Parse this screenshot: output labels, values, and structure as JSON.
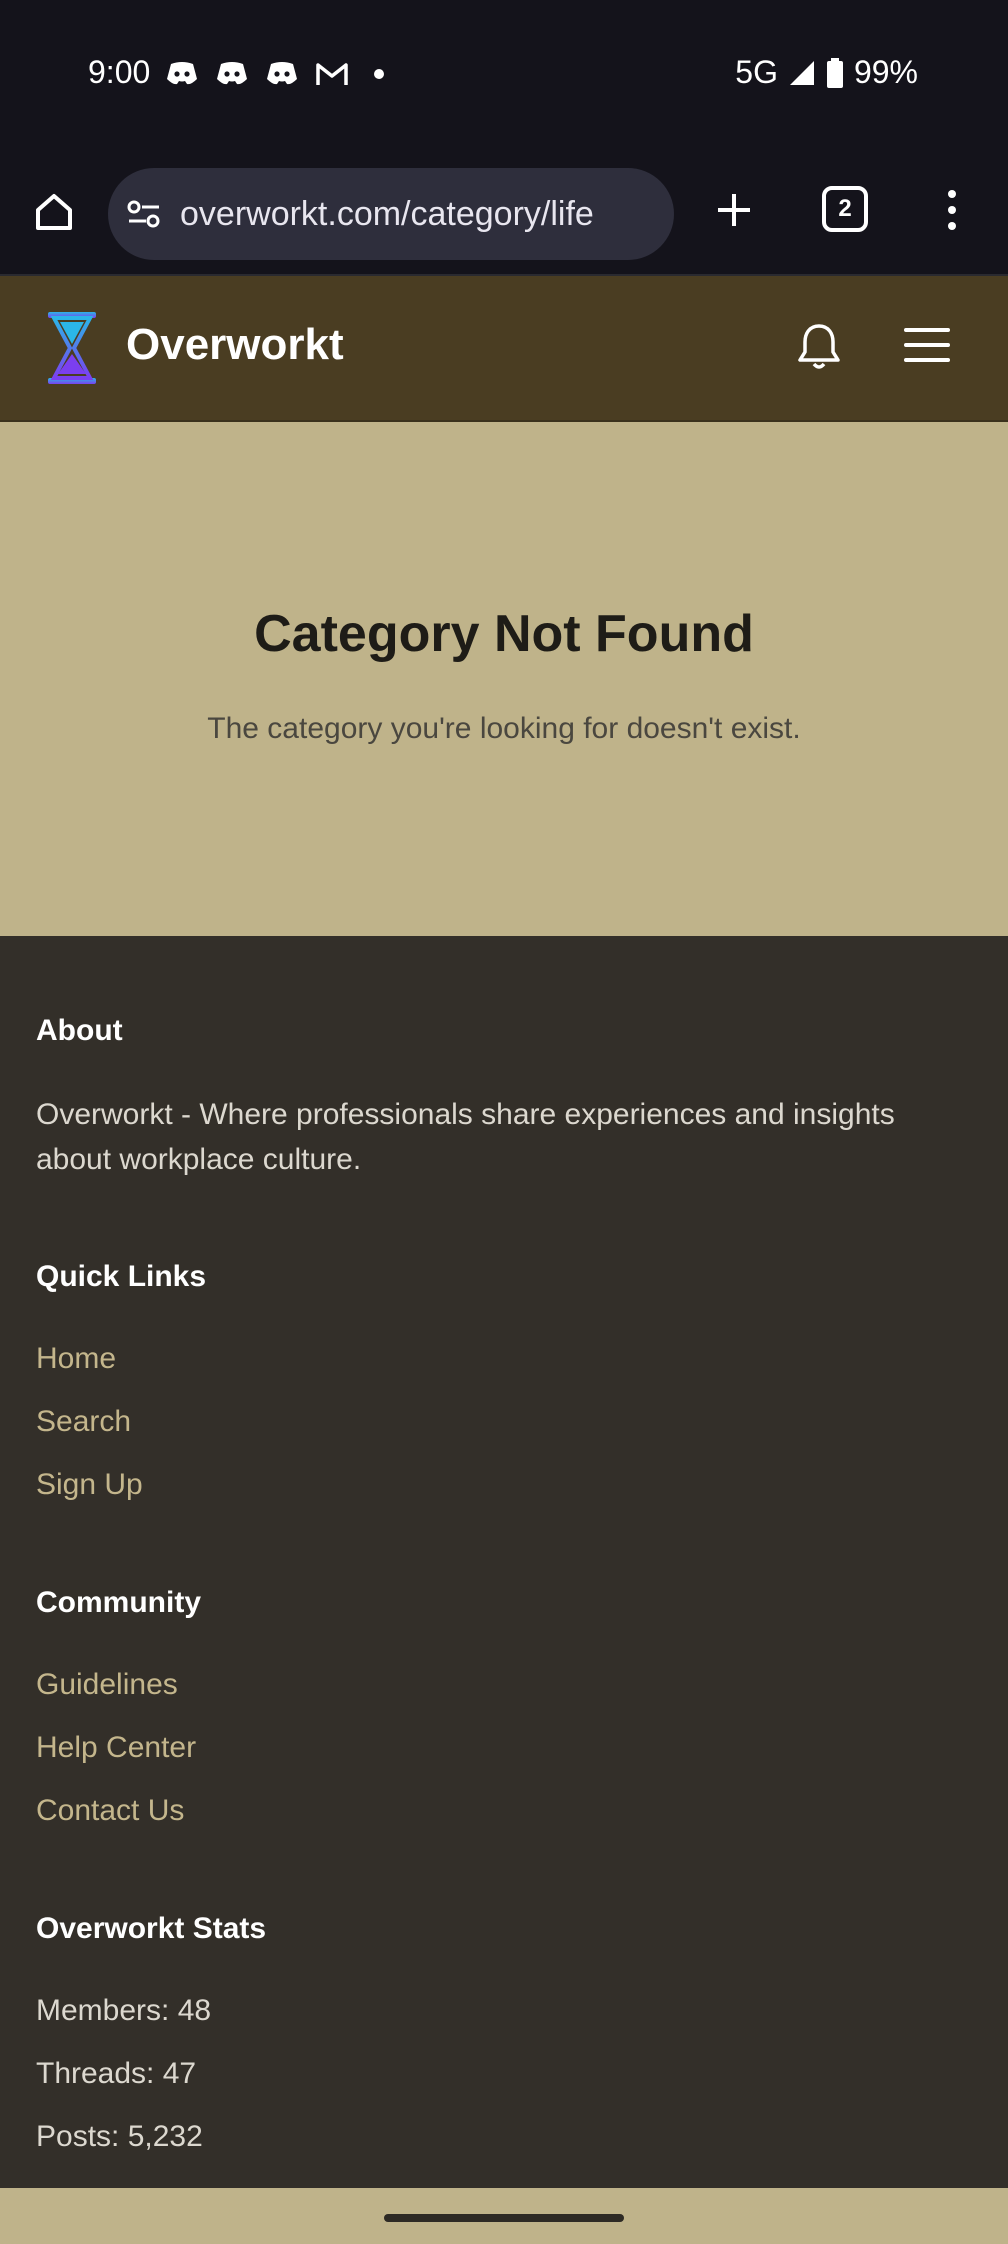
{
  "status_bar": {
    "time": "9:00",
    "network": "5G",
    "battery": "99%",
    "notification_icons": [
      "discord-icon",
      "discord-icon",
      "discord-icon",
      "gmail-icon"
    ]
  },
  "browser": {
    "url": "overworkt.com/category/life",
    "tab_count": "2"
  },
  "site": {
    "name": "Overworkt"
  },
  "main": {
    "title": "Category Not Found",
    "subtitle": "The category you're looking for doesn't exist."
  },
  "footer": {
    "about": {
      "heading": "About",
      "text": "Overworkt - Where professionals share experiences and insights about workplace culture."
    },
    "quick_links": {
      "heading": "Quick Links",
      "items": [
        "Home",
        "Search",
        "Sign Up"
      ]
    },
    "community": {
      "heading": "Community",
      "items": [
        "Guidelines",
        "Help Center",
        "Contact Us"
      ]
    },
    "stats": {
      "heading": "Overworkt Stats",
      "items": [
        "Members: 48",
        "Threads: 47",
        "Posts: 5,232"
      ]
    }
  },
  "colors": {
    "header_bg": "#4a3d22",
    "main_bg": "#bfb38a",
    "footer_bg": "#332f29",
    "link": "#c4b68c"
  }
}
